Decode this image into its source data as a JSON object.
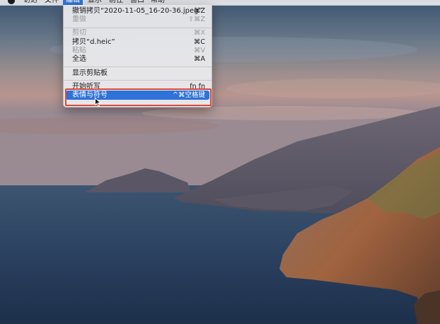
{
  "menubar": {
    "items": [
      {
        "label": "访达"
      },
      {
        "label": "文件"
      },
      {
        "label": "编辑",
        "active": true
      },
      {
        "label": "显示"
      },
      {
        "label": "前往"
      },
      {
        "label": "窗口"
      },
      {
        "label": "帮助"
      }
    ]
  },
  "edit_menu": {
    "items": [
      {
        "label": "撤销拷贝“2020-11-05_16-20-36.jpeg”",
        "shortcut": "⌘Z"
      },
      {
        "label": "重做",
        "shortcut": "⇧⌘Z"
      },
      {
        "label": "剪切",
        "shortcut": "⌘X"
      },
      {
        "label": "拷贝“d.heic”",
        "shortcut": "⌘C"
      },
      {
        "label": "粘贴",
        "shortcut": "⌘V"
      },
      {
        "label": "全选",
        "shortcut": "⌘A"
      },
      {
        "label": "显示剪贴板",
        "shortcut": ""
      },
      {
        "label": "开始听写",
        "shortcut": "fn fn"
      },
      {
        "label": "表情与符号",
        "shortcut": "^⌘空格键"
      }
    ]
  },
  "colors": {
    "accent": "#2f72d8",
    "highlight_border": "#d94a3d"
  }
}
